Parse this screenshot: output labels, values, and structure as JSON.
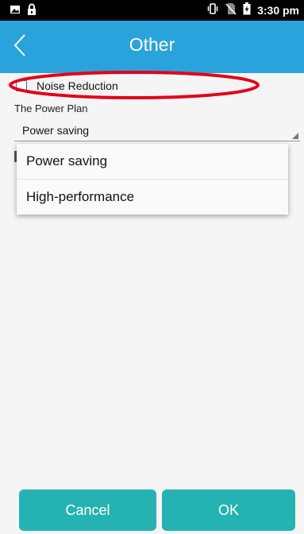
{
  "status_bar": {
    "time": "3:30 pm",
    "left_icons": [
      "image-icon",
      "lock-icon"
    ],
    "right_icons": [
      "vibrate-icon",
      "no-sim-icon",
      "battery-charging-icon"
    ]
  },
  "header": {
    "title": "Other",
    "back_icon": "back-chevron-icon",
    "color": "#2aa3dc"
  },
  "settings": {
    "noise_reduction_label": "Noise Reduction",
    "noise_reduction_checked": false,
    "power_plan_label": "The Power Plan",
    "power_plan_value": "Power saving"
  },
  "dropdown": {
    "options": [
      "Power saving",
      "High-performance"
    ]
  },
  "buttons": {
    "cancel_label": "Cancel",
    "ok_label": "OK",
    "color": "#25b2b2"
  },
  "annotation": {
    "highlight_color": "#e3001b"
  }
}
